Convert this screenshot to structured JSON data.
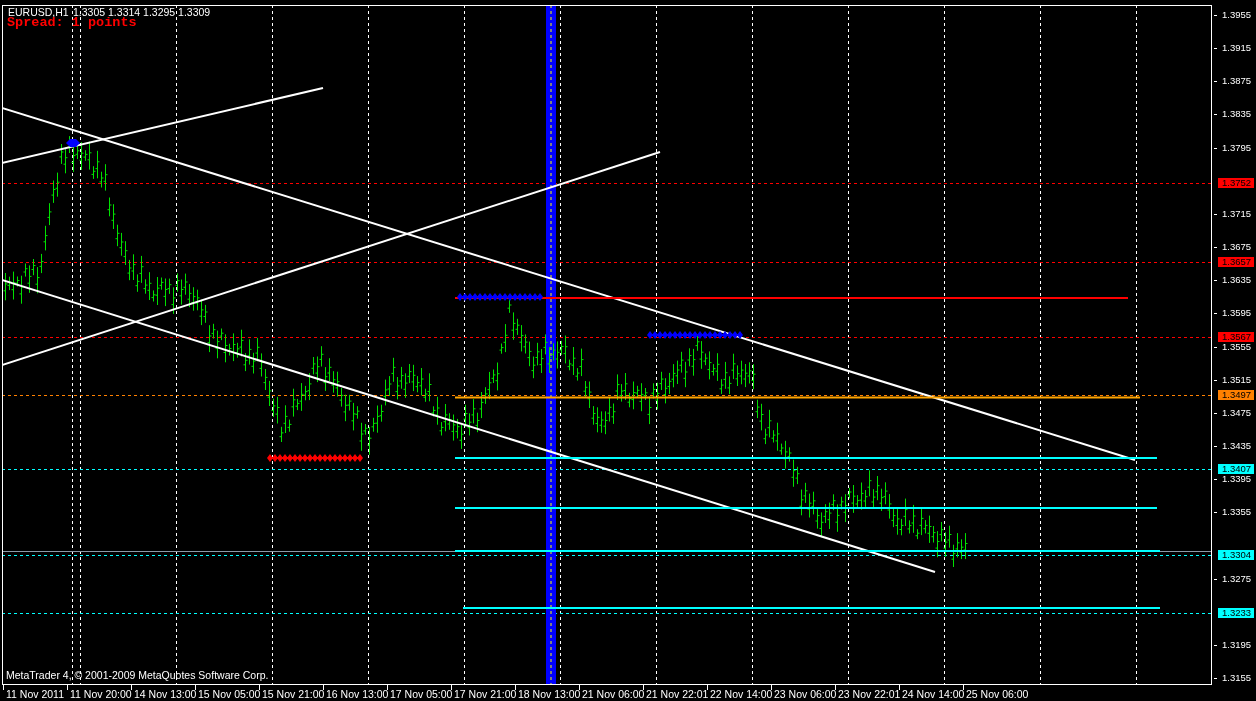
{
  "chart": {
    "symbol": "EURUSD,H1",
    "quote": "1.3305 1.3314 1.3295 1.3309",
    "spread": "Spread: 1 points",
    "copyright": "MetaTrader 4, © 2001-2009 MetaQuotes Software Corp."
  },
  "price_axis": {
    "labels": [
      "1.3955",
      "1.3915",
      "1.3875",
      "1.3835",
      "1.3795",
      "1.3715",
      "1.3675",
      "1.3635",
      "1.3595",
      "1.3555",
      "1.3515",
      "1.3475",
      "1.3435",
      "1.3395",
      "1.3355",
      "1.3275",
      "1.3195",
      "1.3155"
    ],
    "levels": [
      {
        "label": "1.3752",
        "color": "#ff0000"
      },
      {
        "label": "1.3657",
        "color": "#ff0000"
      },
      {
        "label": "1.3567",
        "color": "#ff0000"
      },
      {
        "label": "1.3497",
        "color": "#ff8000"
      },
      {
        "label": "1.3407",
        "color": "#00ffff"
      },
      {
        "label": "1.3304",
        "color": "#00ffff"
      },
      {
        "label": "1.3233",
        "color": "#00ffff"
      }
    ]
  },
  "time_axis": {
    "labels": [
      "11 Nov 2011",
      "11 Nov 20:00",
      "14 Nov 13:00",
      "15 Nov 05:00",
      "15 Nov 21:00",
      "16 Nov 13:00",
      "17 Nov 05:00",
      "17 Nov 21:00",
      "18 Nov 13:00",
      "21 Nov 06:00",
      "21 Nov 22:01",
      "22 Nov 14:00",
      "23 Nov 06:00",
      "23 Nov 22:01",
      "24 Nov 14:00",
      "25 Nov 06:00"
    ]
  }
}
